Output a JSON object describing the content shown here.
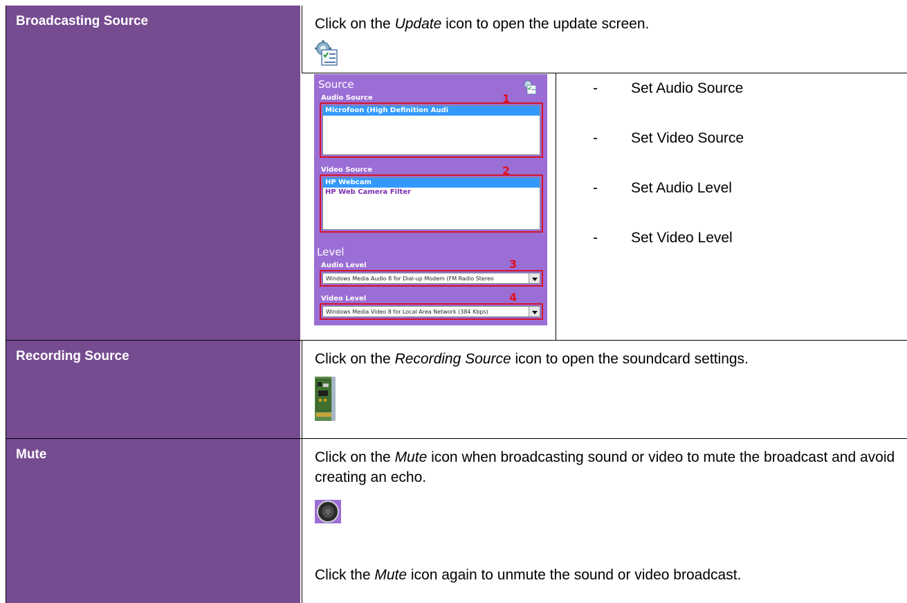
{
  "rows": [
    {
      "label": "Broadcasting Source",
      "instruction_pre": "Click on the ",
      "instruction_em": "Update",
      "instruction_post": " icon to open the update screen.",
      "icon": "update-settings-icon"
    },
    {
      "label": "Recording Source",
      "instruction_pre": "Click on the ",
      "instruction_em": "Recording Source",
      "instruction_post": " icon to open the soundcard settings.",
      "icon": "soundcard-icon"
    },
    {
      "label": "Mute",
      "instruction_pre": "Click on the ",
      "instruction_em": "Mute",
      "instruction_post": " icon when broadcasting sound or video to mute the broadcast and avoid creating an echo.",
      "icon": "speaker-icon",
      "second_pre": "Click the ",
      "second_em": "Mute",
      "second_post": " icon again to unmute the sound or video broadcast."
    }
  ],
  "panel": {
    "title": "Source",
    "audio_source_label": "Audio Source",
    "audio_sources": [
      "Microfoon (High Definition Audi"
    ],
    "video_source_label": "Video Source",
    "video_sources": [
      "HP Webcam",
      "HP Web Camera Filter"
    ],
    "level_title": "Level",
    "audio_level_label": "Audio Level",
    "audio_level_value": "Windows Media Audio 8 for Dial-up Modem (FM Radio Stereo",
    "video_level_label": "Video Level",
    "video_level_value": "Windows Media Video 8 for Local Area Network (384 Kbps)",
    "markers": [
      "1",
      "2",
      "3",
      "4"
    ]
  },
  "steps": [
    "Set Audio Source",
    "Set Video Source",
    "Set Audio Level",
    "Set Video Level"
  ],
  "colors": {
    "label_bg": "#764C91",
    "panel_bg": "#9B6ED5",
    "marker_red": "#D2152A"
  }
}
